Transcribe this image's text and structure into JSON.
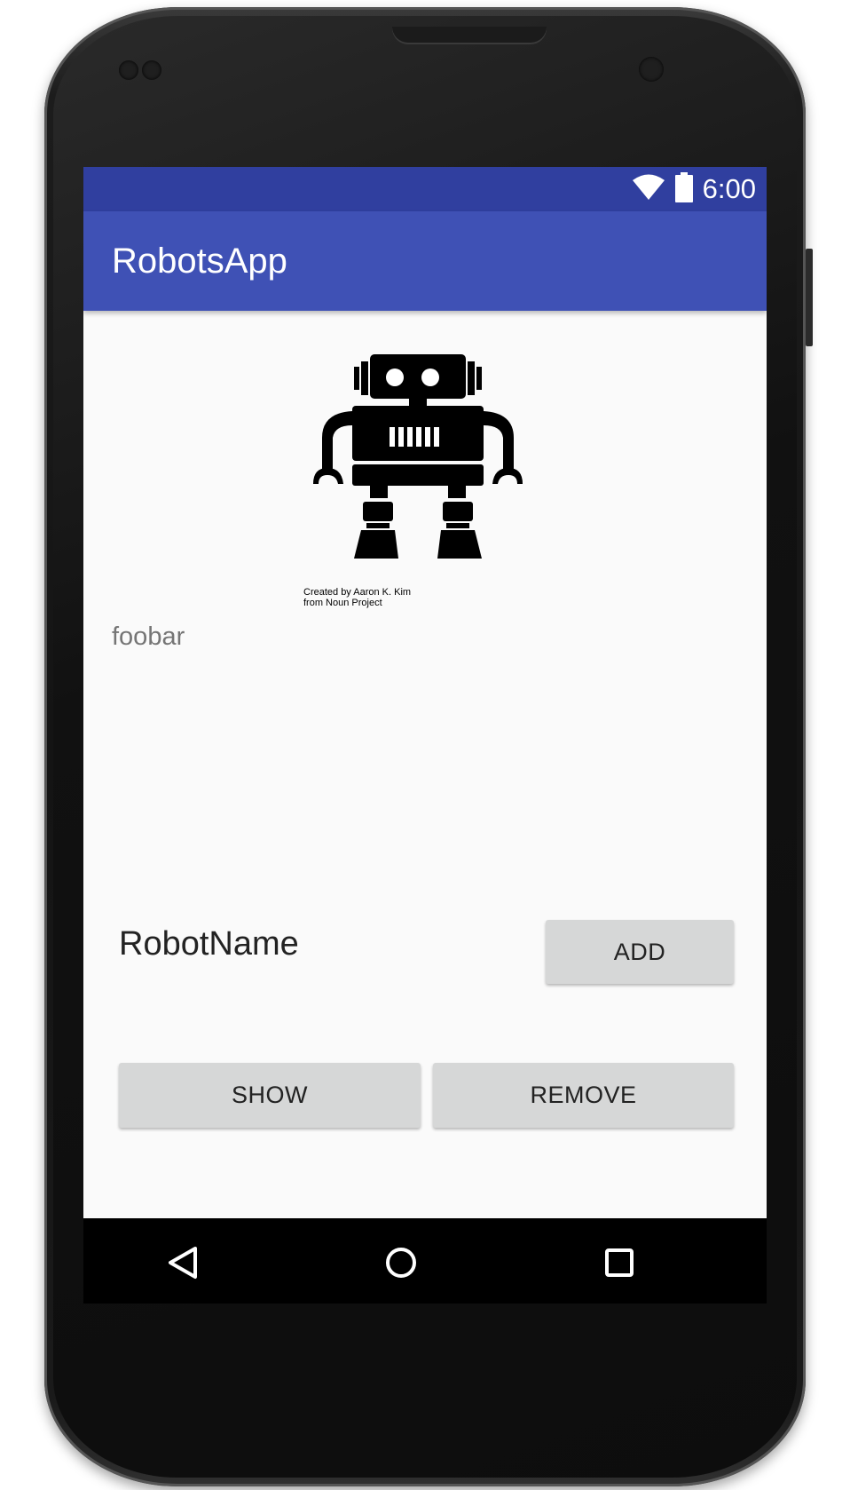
{
  "status_bar": {
    "time": "6:00",
    "icons": [
      "wifi-icon",
      "battery-icon"
    ],
    "color": "#303f9f"
  },
  "app_bar": {
    "title": "RobotsApp",
    "color": "#3f51b5"
  },
  "image": {
    "icon": "robot-icon",
    "credit_line1": "Created by Aaron K. Kim",
    "credit_line2": "from Noun Project"
  },
  "content": {
    "foobar_text": "foobar",
    "robot_name": "RobotName"
  },
  "buttons": {
    "add": "ADD",
    "show": "SHOW",
    "remove": "REMOVE"
  },
  "nav_bar": {
    "icons": [
      "back-icon",
      "home-icon",
      "recents-icon"
    ]
  }
}
